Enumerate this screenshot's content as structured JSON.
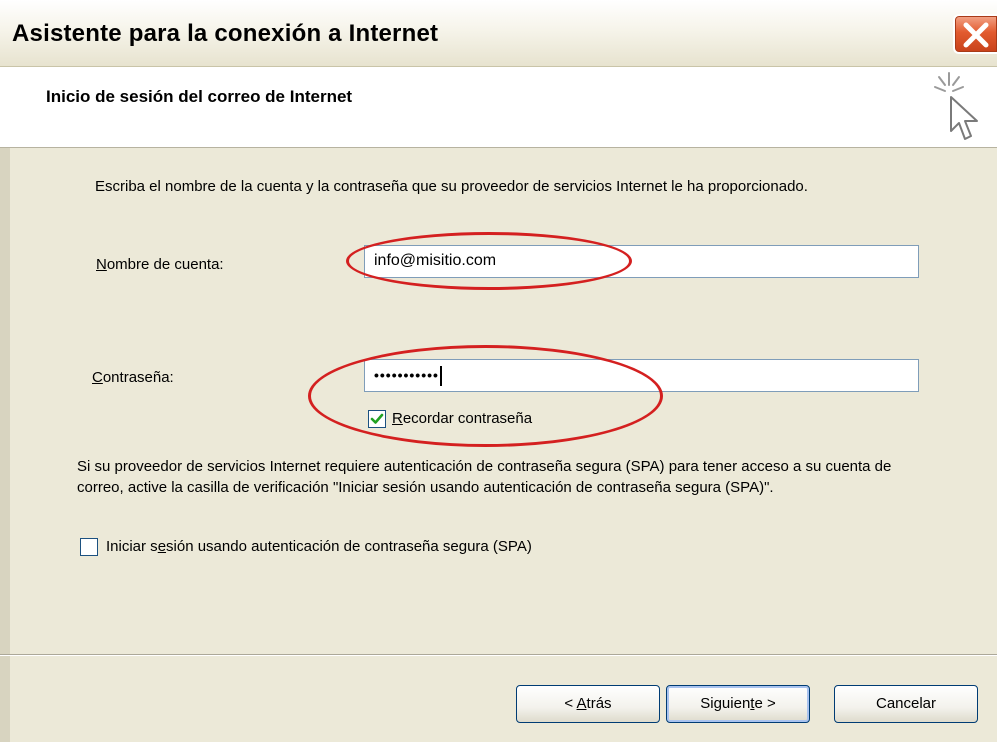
{
  "window": {
    "title": "Asistente para la conexión a Internet"
  },
  "header": {
    "title": "Inicio de sesión del correo de Internet"
  },
  "content": {
    "instructions": "Escriba el nombre de la cuenta y la contraseña que su proveedor de servicios Internet le ha proporcionado.",
    "account": {
      "label_first": "N",
      "label_rest": "ombre de cuenta:",
      "value": "info@misitio.com"
    },
    "password": {
      "label_first": "C",
      "label_rest": "ontraseña:",
      "value": "•••••••••••"
    },
    "remember": {
      "label_first": "R",
      "label_rest": "ecordar contraseña",
      "checked": true
    },
    "spa_info": "Si su proveedor de servicios Internet requiere autenticación de contraseña segura (SPA) para tener acceso a su cuenta de correo, active la casilla de verificación \"Iniciar sesión usando autenticación de contraseña segura (SPA)\".",
    "spa_checkbox": {
      "label_pre": "Iniciar s",
      "label_ul": "e",
      "label_post": "sión usando autenticación de contraseña segura (SPA)",
      "checked": false
    }
  },
  "buttons": {
    "back_pre": "< ",
    "back_ul": "A",
    "back_post": "trás",
    "next_pre": "Siguien",
    "next_ul": "t",
    "next_post": "e >",
    "cancel": "Cancelar"
  },
  "icons": {
    "close": "close-icon",
    "wizard": "wizard-sparkle-cursor-icon",
    "checkmark": "checkmark-icon"
  },
  "colors": {
    "highlight_ellipse": "#d42020",
    "close_button": "#e25b2f",
    "dialog_background": "#ece9d8"
  }
}
